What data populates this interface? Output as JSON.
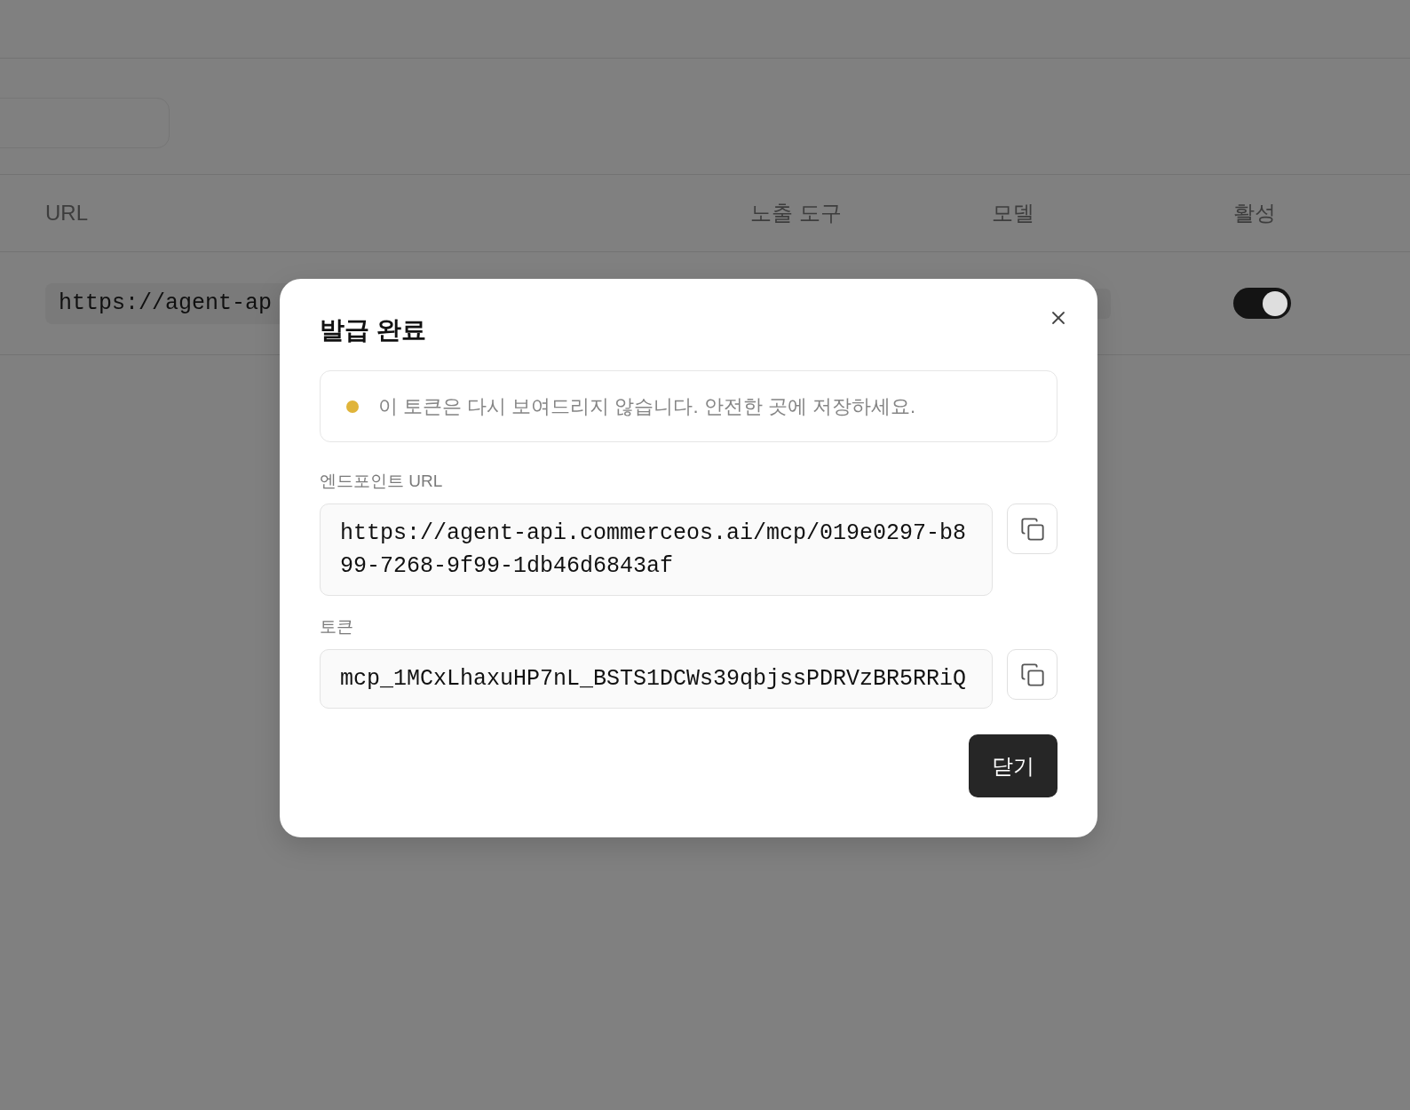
{
  "table": {
    "columns": [
      "URL",
      "노출 도구",
      "모델",
      "활성"
    ],
    "rows": [
      {
        "url": "https://agent-ap",
        "active": true
      }
    ]
  },
  "dialog": {
    "title": "발급 완료",
    "notice": "이 토큰은 다시 보여드리지 않습니다. 안전한 곳에 저장하세요.",
    "fields": [
      {
        "label": "엔드포인트 URL",
        "value": "https://agent-api.commerceos.ai/mcp/019e0297-b899-7268-9f99-1db46d6843af"
      },
      {
        "label": "토큰",
        "value": "mcp_1MCxLhaxuHP7nL_BSTS1DCWs39qbjssPDRVzBR5RRiQ"
      }
    ],
    "close_button": "닫기"
  }
}
